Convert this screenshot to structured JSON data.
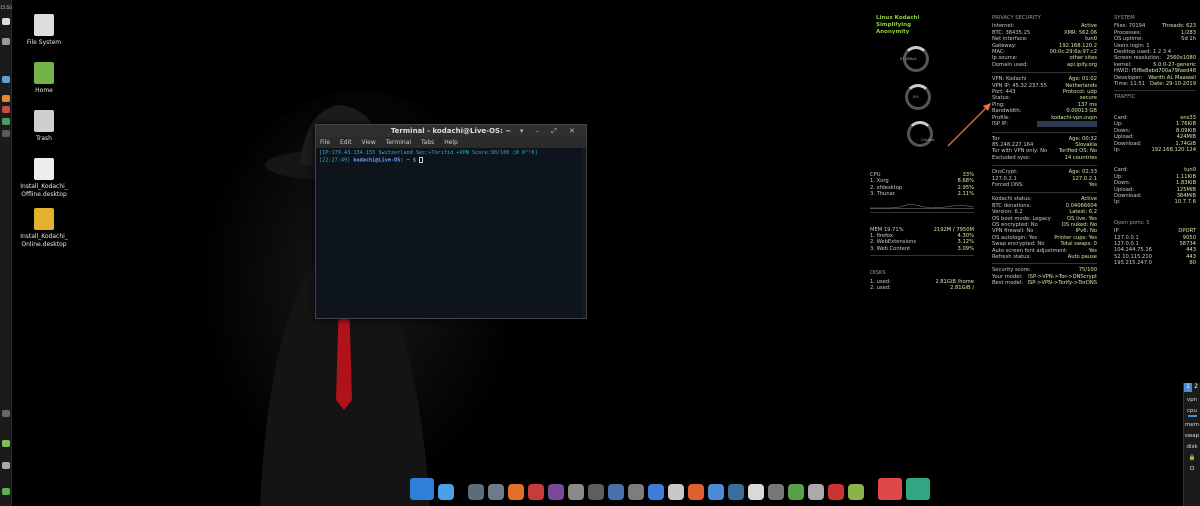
{
  "left_panel": {
    "clock": "15:50"
  },
  "desktop_icons": [
    {
      "name": "file-system-icon",
      "label": "File System",
      "color": "#dddddd"
    },
    {
      "name": "home-folder-icon",
      "label": "Home",
      "color": "#74b24a"
    },
    {
      "name": "trash-icon",
      "label": "Trash",
      "color": "#cfcfcf"
    },
    {
      "name": "install-offline-icon",
      "label": "Install_Kodachi_ Offline.desktop",
      "color": "#eeeeee"
    },
    {
      "name": "install-online-icon",
      "label": "Install_Kodachi_ Online.desktop",
      "color": "#e3b12d"
    }
  ],
  "terminal": {
    "title": "Terminal - kodachi@Live-OS: ~",
    "controls": "▾ – ⤢ ✕",
    "menu": [
      "File",
      "Edit",
      "View",
      "Terminal",
      "Tabs",
      "Help"
    ],
    "line1": "[IP:179.43.134.155 Switzerland Sec:+Torifid +VPN Score:90/100 ◯0 0^!0]",
    "line2_time": "[22:27:49]",
    "line2_user": "kodachi@Live-OS:",
    "line2_path": "~ $"
  },
  "logo": {
    "line1": "Linux Kodachi",
    "line2": "Simplifying Anonymity"
  },
  "gauges": [
    {
      "label": "67.0Mb/s"
    },
    {
      "label": "0%"
    },
    {
      "label": "Cached"
    }
  ],
  "cpu": {
    "title": "CPU",
    "percent": "33%",
    "procs": [
      [
        "1. Xorg",
        "8.68%"
      ],
      [
        "2. xfdesktop",
        "2.95%"
      ],
      [
        "3. Thunar",
        "2.11%"
      ]
    ]
  },
  "mem": {
    "title": "MEM 19.71%",
    "value": "2192M / 7950M",
    "procs": [
      [
        "1. firefox",
        "4.30%"
      ],
      [
        "2. WebExtensions",
        "3.12%"
      ],
      [
        "3. Web Content",
        "3.09%"
      ]
    ]
  },
  "disks": {
    "title": "DISKS",
    "rows": [
      [
        "1. used:",
        "2.81GiB /home"
      ],
      [
        "2. used:",
        "2.81GiB /"
      ]
    ]
  },
  "privacy": {
    "title": "PRIVACY SECURITY",
    "rows": [
      [
        "Internet:",
        "Active"
      ],
      [
        "BTC: 38435.25",
        "XMR: 562.06"
      ],
      [
        "Net interface:",
        "tun0"
      ],
      [
        "Gateway:",
        "192.168.120.2"
      ],
      [
        "MAC:",
        "00:0c:29:6a:97:c2"
      ],
      [
        "Ip source:",
        "other sites"
      ],
      [
        "Domain used:",
        "api.ipify.org"
      ]
    ],
    "vpn": [
      [
        "VPN: Kodachi",
        "Age: 01:02"
      ],
      [
        "VPN IP: 45.32.237.55",
        "Netherlands"
      ],
      [
        "Port: 443",
        "Protocol: udp"
      ],
      [
        "Status:",
        "secure"
      ],
      [
        "Ping:",
        "137 ms"
      ],
      [
        "Bandwidth:",
        "0.00013 GB"
      ],
      [
        "Profile:",
        "kodachi-vpn.ovpn"
      ],
      [
        "ISP IP:",
        ""
      ]
    ],
    "tor": [
      [
        "Tor",
        "Age: 00:32"
      ],
      [
        "85.248.227.164",
        "Slovakia"
      ],
      [
        "Tor with VPN only: No",
        "Torified OS: No"
      ],
      [
        "Excluded syss:",
        "14 countries"
      ]
    ],
    "dns": [
      [
        "DnsCrypt:",
        "Age: 02:33"
      ],
      [
        "127.0.2.1",
        "127.0.2.1"
      ],
      [
        "Forced DNS:",
        "Yes"
      ]
    ],
    "kodachi": [
      [
        "Kodachi status:",
        "Active"
      ],
      [
        "BTC donations:",
        "0.04066604"
      ],
      [
        "Version: 6.2",
        "Latest: 6.2"
      ],
      [
        "OS boot mode: Legacy",
        "OS live: Yes"
      ],
      [
        "OS encrypted: No",
        "OS nuked: No"
      ],
      [
        "VPN firewall: No",
        "IPv6: No"
      ],
      [
        "OS autologin: Yes",
        "Printer cups: Yes"
      ],
      [
        "Swap encrypted: No",
        "Total swaps: 0"
      ],
      [
        "Auto screen font adjustment:",
        "Yes"
      ],
      [
        "Refresh status:",
        "Auto pause"
      ]
    ],
    "security": [
      [
        "Security score:",
        "75/100"
      ],
      [
        "Your model:",
        "ISP->VPN->Tor->DNScrypt"
      ],
      [
        "Best model:",
        "ISP->VPN->Torify->TorDNS"
      ]
    ]
  },
  "system": {
    "title": "SYSTEM",
    "rows": [
      [
        "Files: 70194",
        "Threads: 623"
      ],
      [
        "Processes:",
        "1/283"
      ],
      [
        "OS uptime:",
        "5d 1h"
      ],
      [
        "Users login: 1",
        ""
      ],
      [
        "Desktop used: 1 2 3 4",
        ""
      ],
      [
        "Screen resolution:",
        "2560x1080"
      ],
      [
        "kernel:",
        "5.0.0-27-generic"
      ],
      [
        "HWID:",
        "f5f8e8ebd700a79faed48"
      ],
      [
        "Developer:",
        "Warith AL Maawali"
      ],
      [
        "Time: 11:51",
        "Date: 29-10-2019"
      ]
    ]
  },
  "traffic": {
    "title": "TRAFFIC",
    "card1": [
      [
        "Card:",
        "ens33"
      ],
      [
        "Up:",
        "1.76KiB"
      ],
      [
        "Down:",
        "8.09KiB"
      ],
      [
        "Upload:",
        "424MiB"
      ],
      [
        "Download:",
        "1.74GiB"
      ],
      [
        "Ip:",
        "192.168.120.124"
      ]
    ],
    "card2": [
      [
        "Card:",
        "tun0"
      ],
      [
        "Up:",
        "1.11KiB"
      ],
      [
        "Down:",
        "1.83KiB"
      ],
      [
        "Upload:",
        "125MiB"
      ],
      [
        "Download:",
        "384MiB"
      ],
      [
        "Ip:",
        "10.7.7.6"
      ]
    ],
    "open_ports_label": "Open ports: 5",
    "ports_header": [
      "IP",
      "DPORT"
    ],
    "ports": [
      [
        "127.0.0.1",
        "9050"
      ],
      [
        "127.0.0.1",
        "58734"
      ],
      [
        "104.244.75.16",
        "443"
      ],
      [
        "52.10.115.210",
        "443"
      ],
      [
        "195.215.247.0",
        "80"
      ]
    ]
  },
  "right_panel": {
    "workspaces": [
      "1",
      "2"
    ],
    "labels": [
      "vpn",
      "cpu",
      "mem",
      "swap",
      "disk"
    ]
  },
  "dock": [
    {
      "name": "screen-icon",
      "color": "#2e7fd6",
      "big": true
    },
    {
      "name": "magnifier-icon",
      "color": "#4aa0e8"
    },
    {
      "sep": true
    },
    {
      "name": "kodachi-icon-1",
      "color": "#5b6d7d"
    },
    {
      "name": "kodachi-icon-2",
      "color": "#6a7c8a"
    },
    {
      "name": "firefox-icon",
      "color": "#e36f2b"
    },
    {
      "name": "shield-icon",
      "color": "#c93a3a"
    },
    {
      "name": "tor-icon",
      "color": "#7a4a9a"
    },
    {
      "name": "tools-icon",
      "color": "#8a8a8a"
    },
    {
      "name": "script-icon",
      "color": "#5e5e5e"
    },
    {
      "name": "app-icon-8",
      "color": "#4b6fa8"
    },
    {
      "name": "app-icon-9",
      "color": "#7d7d7d"
    },
    {
      "name": "app-icon-10",
      "color": "#3e7bd4"
    },
    {
      "name": "app-icon-11",
      "color": "#c8c8c8"
    },
    {
      "name": "app-icon-12",
      "color": "#e06030"
    },
    {
      "name": "app-icon-13",
      "color": "#4f8ad6"
    },
    {
      "name": "app-icon-14",
      "color": "#3a6e9a"
    },
    {
      "name": "app-icon-15",
      "color": "#d9d9d9"
    },
    {
      "name": "app-icon-16",
      "color": "#777777"
    },
    {
      "name": "app-icon-17",
      "color": "#56a04a"
    },
    {
      "name": "app-icon-18",
      "color": "#aaaaaa"
    },
    {
      "name": "app-icon-19",
      "color": "#cc3333"
    },
    {
      "name": "app-icon-20",
      "color": "#8ab34a"
    },
    {
      "sep": true
    },
    {
      "name": "signal-icon",
      "color": "#e04848",
      "big": true
    },
    {
      "name": "vpn-shield-icon",
      "color": "#34a583",
      "big": true
    }
  ]
}
